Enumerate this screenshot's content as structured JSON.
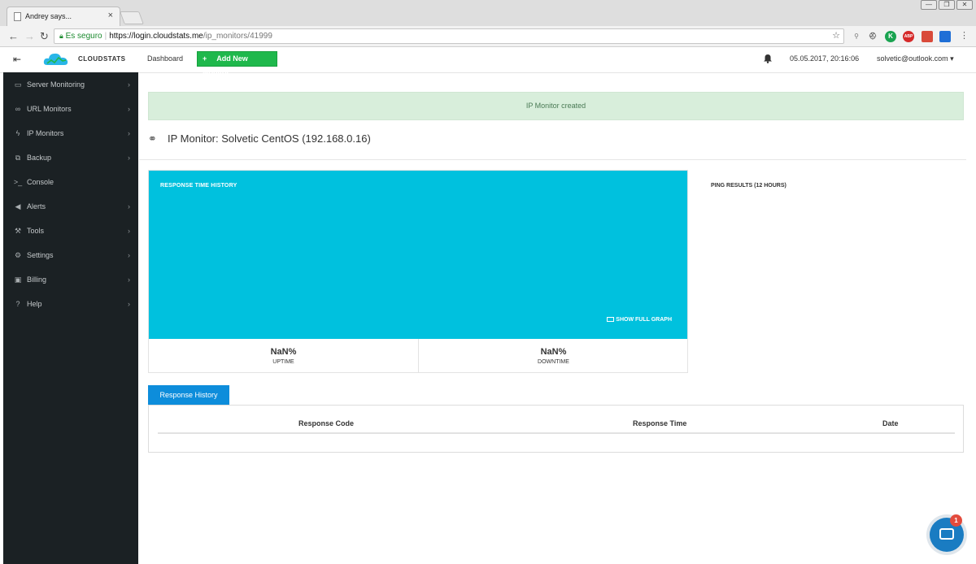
{
  "browser": {
    "tab_title": "Andrey says...",
    "tab_close": "×",
    "secure_label": "Es seguro",
    "url_host": "https://login.cloudstats.me",
    "url_path": "/ip_monitors/41999",
    "window_controls": [
      "—",
      "❐",
      "✕"
    ]
  },
  "header": {
    "brand": "CLOUDSTATS",
    "dashboard_label": "Dashboard",
    "add_monitor_label": "Add New Monitor",
    "add_monitor_plus": "+",
    "datetime": "05.05.2017, 20:16:06",
    "user_email": "solvetic@outlook.com ▾",
    "brand_color": "#1fb84c"
  },
  "sidebar": {
    "items": [
      {
        "label": "Server Monitoring",
        "icon": "server-icon"
      },
      {
        "label": "URL Monitors",
        "icon": "link-icon"
      },
      {
        "label": "IP Monitors",
        "icon": "bolt-icon"
      },
      {
        "label": "Backup",
        "icon": "copy-icon"
      },
      {
        "label": "Console",
        "icon": "terminal-icon"
      },
      {
        "label": "Alerts",
        "icon": "megaphone-icon"
      },
      {
        "label": "Tools",
        "icon": "wrench-icon"
      },
      {
        "label": "Settings",
        "icon": "gears-icon"
      },
      {
        "label": "Billing",
        "icon": "money-icon"
      },
      {
        "label": "Help",
        "icon": "question-icon"
      }
    ]
  },
  "main": {
    "alert": "IP Monitor created",
    "page_title": "IP Monitor: Solvetic CentOS (192.168.0.16)",
    "graph": {
      "title": "RESPONSE TIME HISTORY",
      "full_graph_label": "SHOW FULL GRAPH",
      "uptime_value": "NaN%",
      "uptime_label": "UPTIME",
      "downtime_value": "NaN%",
      "downtime_label": "DOWNTIME",
      "color": "#00c1de"
    },
    "ping_title": "PING RESULTS (12 HOURS)",
    "response_tab": "Response History",
    "columns": [
      "Response Code",
      "Response Time",
      "Date"
    ]
  },
  "chat": {
    "badge": "1"
  }
}
